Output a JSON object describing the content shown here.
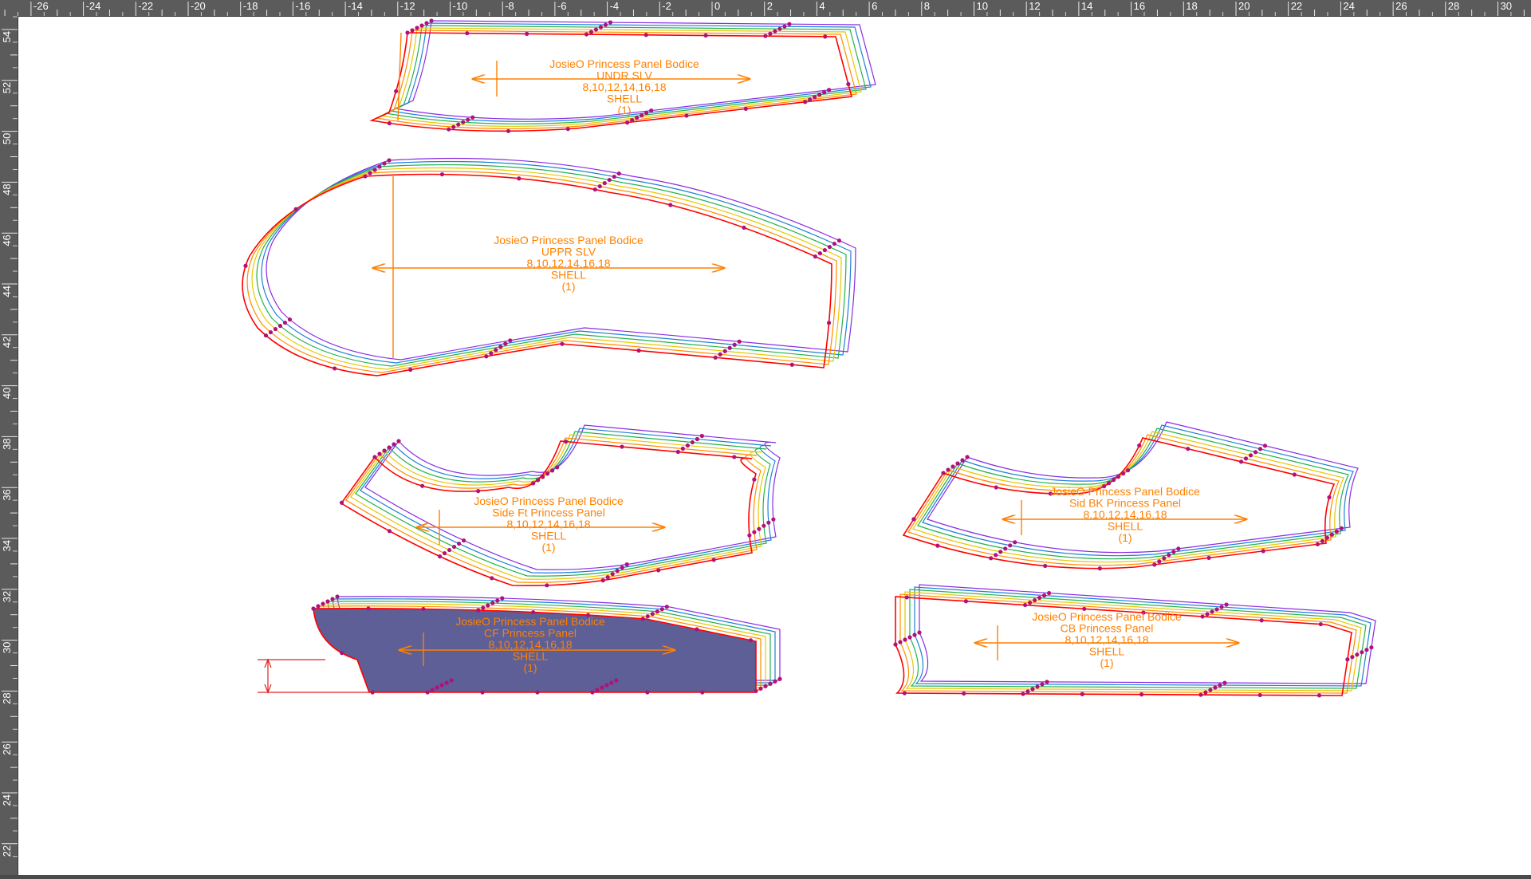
{
  "ruler": {
    "x_labels": [
      "-26",
      "-24",
      "-22",
      "-20",
      "-18",
      "-16",
      "-14",
      "-12",
      "-10",
      "-8",
      "-6",
      "-4",
      "-2",
      "0",
      "2",
      "4",
      "6",
      "8",
      "10",
      "12",
      "14",
      "16",
      "18",
      "20",
      "22",
      "24",
      "26",
      "28",
      "30"
    ],
    "y_labels": [
      "54",
      "52",
      "50",
      "48",
      "46",
      "44",
      "42",
      "40",
      "38",
      "36",
      "34",
      "32",
      "30",
      "28",
      "26",
      "24",
      "22"
    ]
  },
  "colors": {
    "ruler_bg": "#5b5b5b",
    "canvas_bg": "#ffffff",
    "annotation": "#ff8000",
    "point": "#b0127a",
    "selected_fill": "#5d5f96",
    "grade_lines": [
      "#ff0000",
      "#ff8c00",
      "#e6c800",
      "#22b14c",
      "#1e7fd6",
      "#8a2be2"
    ]
  },
  "pieces": [
    {
      "id": "undr-slv",
      "label": [
        "JosieO Princess Panel Bodice",
        "UNDR SLV",
        "8,10,12,14,16,18",
        "SHELL",
        "(1)"
      ],
      "selected": false
    },
    {
      "id": "uppr-slv",
      "label": [
        "JosieO Princess Panel Bodice",
        "UPPR SLV",
        "8,10,12,14,16,18",
        "SHELL",
        "(1)"
      ],
      "selected": false
    },
    {
      "id": "side-ft",
      "label": [
        "JosieO Princess Panel Bodice",
        "Side Ft Princess Panel",
        "8,10,12,14,16,18",
        "SHELL",
        "(1)"
      ],
      "selected": false
    },
    {
      "id": "side-bk",
      "label": [
        "JosieO Princess Panel Bodice",
        "Sid BK Princess Panel",
        "8,10,12,14,16,18",
        "SHELL",
        "(1)"
      ],
      "selected": false
    },
    {
      "id": "cf",
      "label": [
        "JosieO Princess Panel Bodice",
        "CF Princess Panel",
        "8,10,12,14,16,18",
        "SHELL",
        "(1)"
      ],
      "selected": true
    },
    {
      "id": "cb",
      "label": [
        "JosieO Princess Panel Bodice",
        "CB Princess Panel",
        "8,10,12,14,16,18",
        "SHELL",
        "(1)"
      ],
      "selected": false
    }
  ]
}
